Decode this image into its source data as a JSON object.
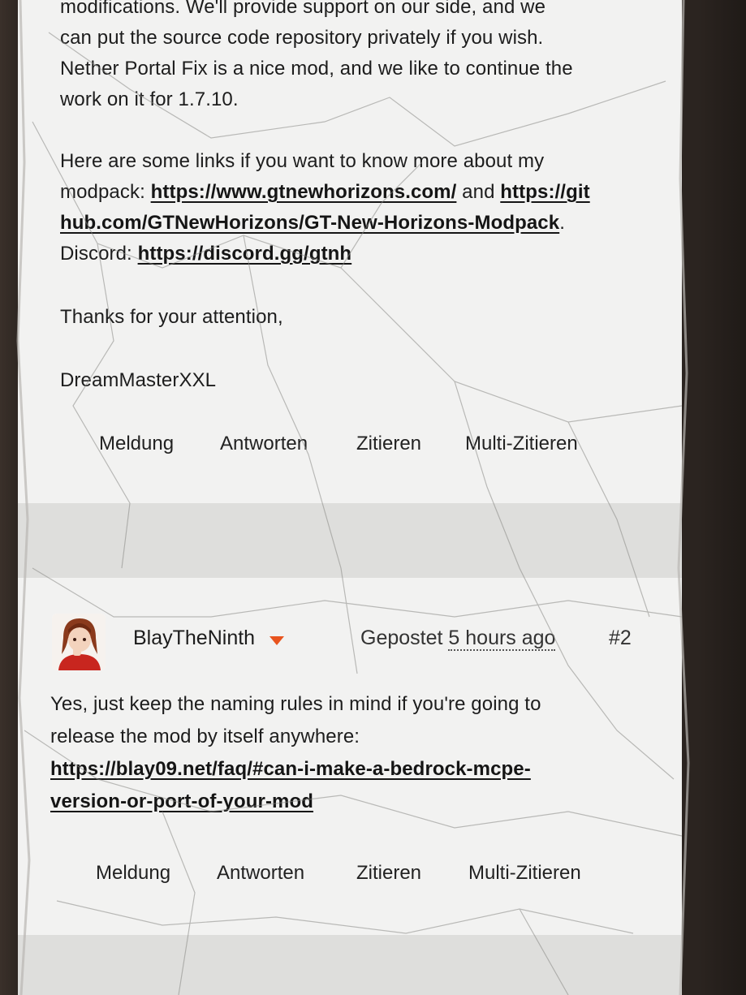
{
  "post1": {
    "paragraph1_lines": [
      "modifications. We'll provide support on our side, and we",
      "can put the source code repository privately if you wish.",
      "Nether Portal Fix is a nice mod, and we like to continue the",
      "work on it for 1.7.10."
    ],
    "links_intro_a": "Here are some links if you want to know more about my",
    "links_intro_b": "modpack: ",
    "link_gtnh_site": "https://www.gtnewhorizons.com/",
    "and_word": " and ",
    "link_github_part1": "https://git",
    "link_github_part2": "hub.com/GTNewHorizons/GT-New-Horizons-Modpack",
    "period": ".",
    "discord_label": "Discord: ",
    "link_discord": "https://discord.gg/gtnh",
    "thanks": "Thanks for your attention,",
    "signature": "DreamMasterXXL",
    "actions": {
      "report": "Meldung",
      "reply": "Antworten",
      "quote": "Zitieren",
      "multi_quote": "Multi-Zitieren"
    }
  },
  "post2": {
    "author": "BlayTheNinth",
    "posted_prefix": "Gepostet ",
    "posted_time": "5 hours ago",
    "post_number": "#2",
    "text_line1": "Yes, just keep the naming rules in mind if you're going to",
    "text_line2": "release the mod by itself anywhere:",
    "link_line1": "https://blay09.net/faq/#can-i-make-a-bedrock-mcpe-",
    "link_line2": "version-or-port-of-your-mod",
    "actions": {
      "report": "Meldung",
      "reply": "Antworten",
      "quote": "Zitieren",
      "multi_quote": "Multi-Zitieren"
    }
  },
  "colors": {
    "accent_caret": "#e8541e",
    "text": "#1d1d1d",
    "card_bg": "#f2f2f1",
    "divider_bg": "#dededc"
  },
  "icons": {
    "user_menu": "caret-down-icon",
    "avatar": "user-avatar-anime-girl"
  }
}
